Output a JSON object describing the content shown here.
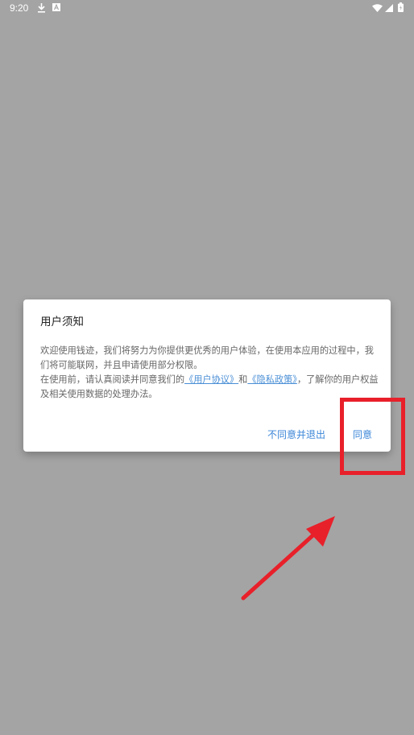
{
  "status_bar": {
    "time": "9:20",
    "icons": [
      "download-icon",
      "a-notification-icon",
      "wifi-icon",
      "signal-icon",
      "battery-icon"
    ]
  },
  "dialog": {
    "title": "用户须知",
    "para1": "欢迎使用钱迹，我们将努力为你提供更优秀的用户体验，在使用本应用的过程中，我们将可能联网，并且申请使用部分权限。",
    "para2_prefix": "在使用前，请认真阅读并同意我们的",
    "user_agreement_link": "《用户协议》",
    "para2_and": "和",
    "privacy_policy_link": "《隐私政策》",
    "para2_suffix": "，了解你的用户权益及相关使用数据的处理办法。",
    "disagree_button": "不同意并退出",
    "agree_button": "同意"
  },
  "annotation": {
    "color": "#e8202a"
  }
}
